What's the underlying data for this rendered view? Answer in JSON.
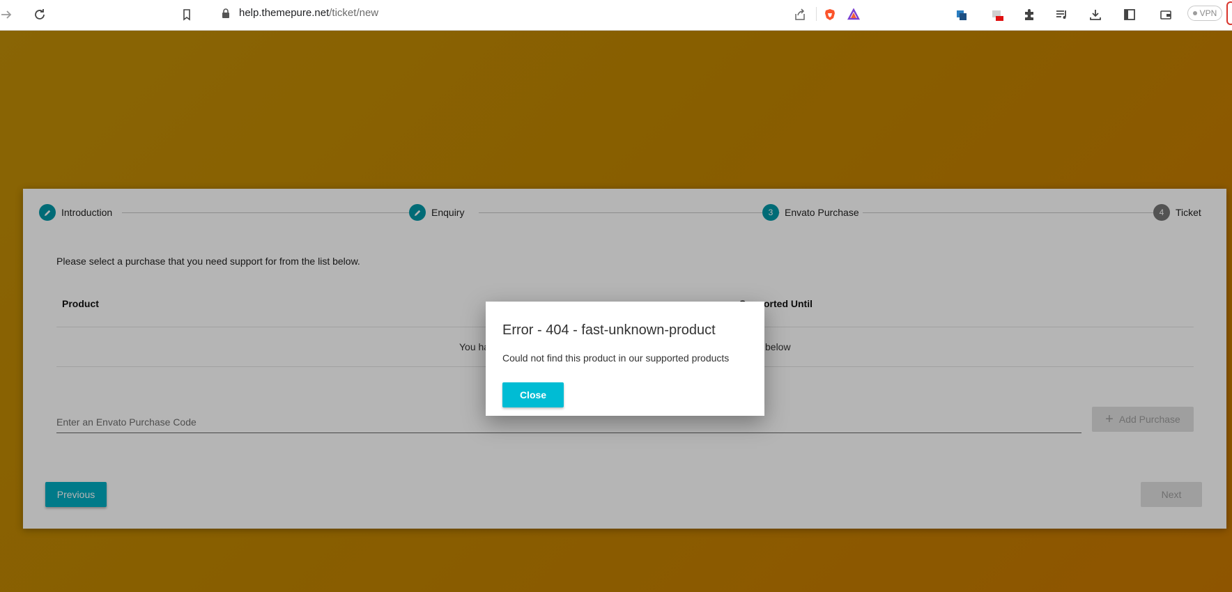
{
  "browser": {
    "url_host": "help.themepure.net",
    "url_path": "/ticket/new",
    "vpn_label": "VPN"
  },
  "stepper": {
    "steps": [
      {
        "label": "Introduction",
        "number": "",
        "state": "edit"
      },
      {
        "label": "Enquiry",
        "number": "",
        "state": "edit"
      },
      {
        "label": "Envato Purchase",
        "number": "3",
        "state": "active"
      },
      {
        "label": "Ticket",
        "number": "4",
        "state": "inactive"
      }
    ]
  },
  "purchase": {
    "intro": "Please select a purchase that you need support for from the list below.",
    "columns": [
      "Product",
      "Supported Until"
    ],
    "empty_left": "You ha",
    "empty_right": "below",
    "code_placeholder": "Enter an Envato Purchase Code",
    "add_button": "Add Purchase"
  },
  "nav": {
    "previous": "Previous",
    "next": "Next"
  },
  "modal": {
    "title": "Error - 404 - fast-unknown-product",
    "message": "Could not find this product in our supported products",
    "close": "Close"
  },
  "colors": {
    "accent": "#00acc1",
    "step_active": "#0097a7",
    "step_inactive": "#757575",
    "background": "#c08500"
  }
}
